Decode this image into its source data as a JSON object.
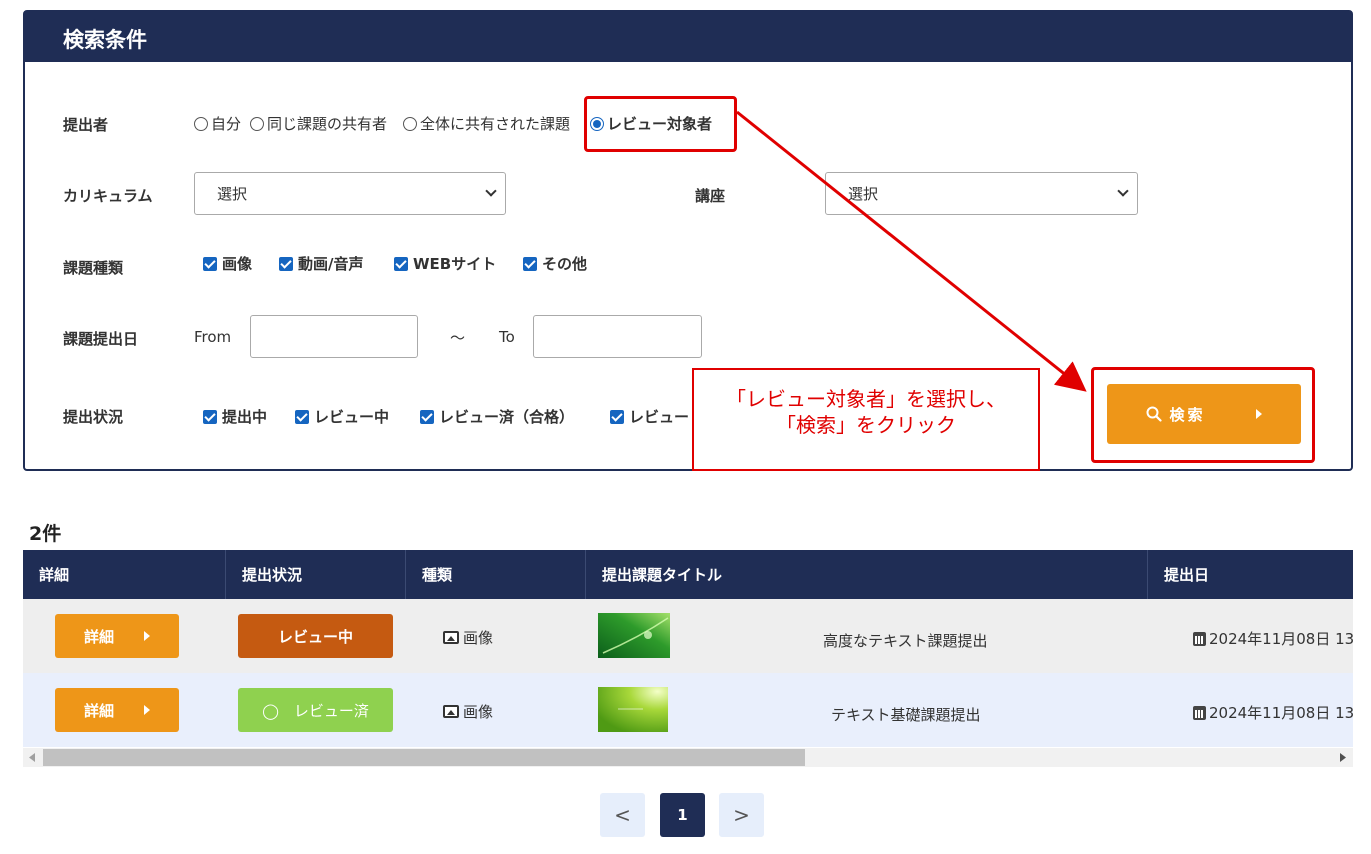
{
  "search_panel": {
    "title": "検索条件",
    "submitter": {
      "label": "提出者",
      "options": [
        "自分",
        "同じ課題の共有者",
        "全体に共有された課題",
        "レビュー対象者"
      ],
      "selected": "レビュー対象者"
    },
    "curriculum": {
      "label": "カリキュラム",
      "value": "選択"
    },
    "course": {
      "label": "講座",
      "value": "選択"
    },
    "task_type": {
      "label": "課題種類",
      "options": [
        "画像",
        "動画/音声",
        "WEBサイト",
        "その他"
      ]
    },
    "submit_date": {
      "label": "課題提出日",
      "from_label": "From",
      "separator": "～",
      "to_label": "To",
      "from_value": "",
      "to_value": ""
    },
    "status": {
      "label": "提出状況",
      "options": [
        "提出中",
        "レビュー中",
        "レビュー済（合格）",
        "レビュー"
      ]
    },
    "search_button": "検索"
  },
  "annotation": {
    "callout_line1": "「レビュー対象者」を選択し、",
    "callout_line2": "「検索」をクリック"
  },
  "results": {
    "count": "2件",
    "columns": [
      "詳細",
      "提出状況",
      "種類",
      "提出課題タイトル",
      "提出日"
    ],
    "rows": [
      {
        "detail": "詳細",
        "status": "レビュー中",
        "kind": "画像",
        "title": "高度なテキスト課題提出",
        "date": "2024年11月08日 13"
      },
      {
        "detail": "詳細",
        "status": "◯　レビュー済",
        "kind": "画像",
        "title": "テキスト基礎課題提出",
        "date": "2024年11月08日 13"
      }
    ]
  },
  "pagination": {
    "prev": "<",
    "current": "1",
    "next": ">"
  },
  "colors": {
    "navy": "#1f2d55",
    "orange": "#ee9618",
    "status_in_review": "#c55a11",
    "status_reviewed": "#8fd14f",
    "annotation_red": "#e00000"
  }
}
